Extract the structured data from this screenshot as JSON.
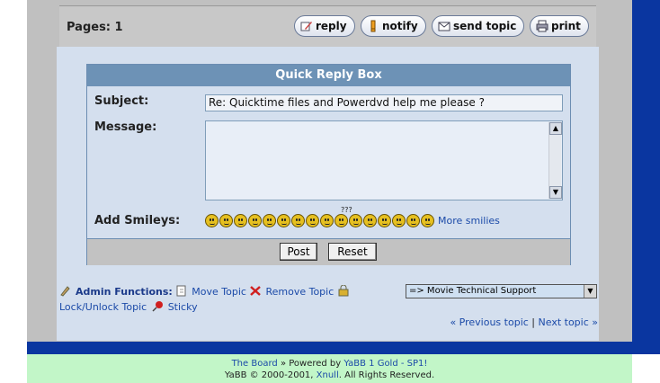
{
  "pages": {
    "label": "Pages: 1"
  },
  "actions": [
    {
      "label": "reply",
      "icon": "pencil-icon"
    },
    {
      "label": "notify",
      "icon": "bell-icon"
    },
    {
      "label": "send topic",
      "icon": "envelope-icon"
    },
    {
      "label": "print",
      "icon": "printer-icon"
    }
  ],
  "quick_reply": {
    "title": "Quick Reply Box",
    "subject_label": "Subject:",
    "subject_value": "Re: Quicktime files and Powerdvd help me please ?",
    "message_label": "Message:",
    "message_value": "",
    "smileys_label": "Add Smileys:",
    "smiley_question": "???",
    "more_smilies": "More smilies",
    "post_button": "Post",
    "reset_button": "Reset"
  },
  "admin": {
    "label": "Admin Functions:",
    "move": "Move Topic",
    "remove": "Remove Topic",
    "lock": "Lock/Unlock Topic",
    "sticky": "Sticky"
  },
  "jump": {
    "selected": "=> Movie Technical Support"
  },
  "nav": {
    "previous": "« Previous topic",
    "separator": "|",
    "next": "Next topic »"
  },
  "footer": {
    "board": "The Board",
    "powered_prefix": "» Powered by",
    "yabb": "YaBB 1 Gold - SP1!",
    "copyright": "YaBB © 2000-2001,",
    "xnull": "Xnull",
    "rights": ". All Rights Reserved."
  }
}
